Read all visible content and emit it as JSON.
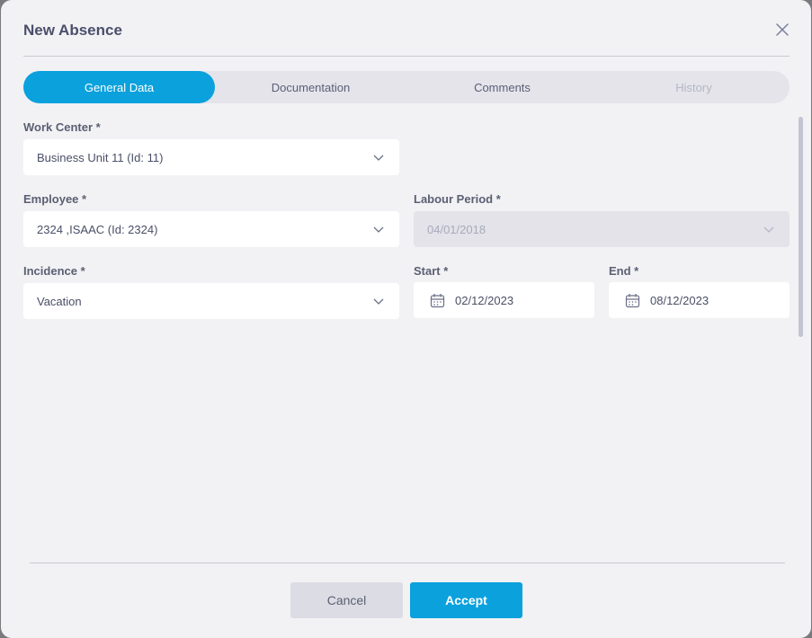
{
  "dialog": {
    "title": "New Absence"
  },
  "tabs": [
    {
      "label": "General Data",
      "state": "active"
    },
    {
      "label": "Documentation",
      "state": "normal"
    },
    {
      "label": "Comments",
      "state": "normal"
    },
    {
      "label": "History",
      "state": "disabled"
    }
  ],
  "form": {
    "work_center": {
      "label": "Work Center *",
      "value": "Business Unit 11 (Id: 11)"
    },
    "employee": {
      "label": "Employee *",
      "value": "2324 ,ISAAC (Id: 2324)"
    },
    "labour_period": {
      "label": "Labour Period *",
      "value": "04/01/2018",
      "disabled": true
    },
    "incidence": {
      "label": "Incidence *",
      "value": "Vacation"
    },
    "start": {
      "label": "Start *",
      "value": "02/12/2023"
    },
    "end": {
      "label": "End *",
      "value": "08/12/2023"
    }
  },
  "footer": {
    "cancel_label": "Cancel",
    "accept_label": "Accept"
  },
  "icons": {
    "close": "close-icon",
    "chevron": "chevron-down-icon",
    "calendar": "calendar-icon"
  },
  "colors": {
    "accent": "#0aa1dd",
    "background": "#f2f2f5",
    "text": "#4a4f6a"
  }
}
